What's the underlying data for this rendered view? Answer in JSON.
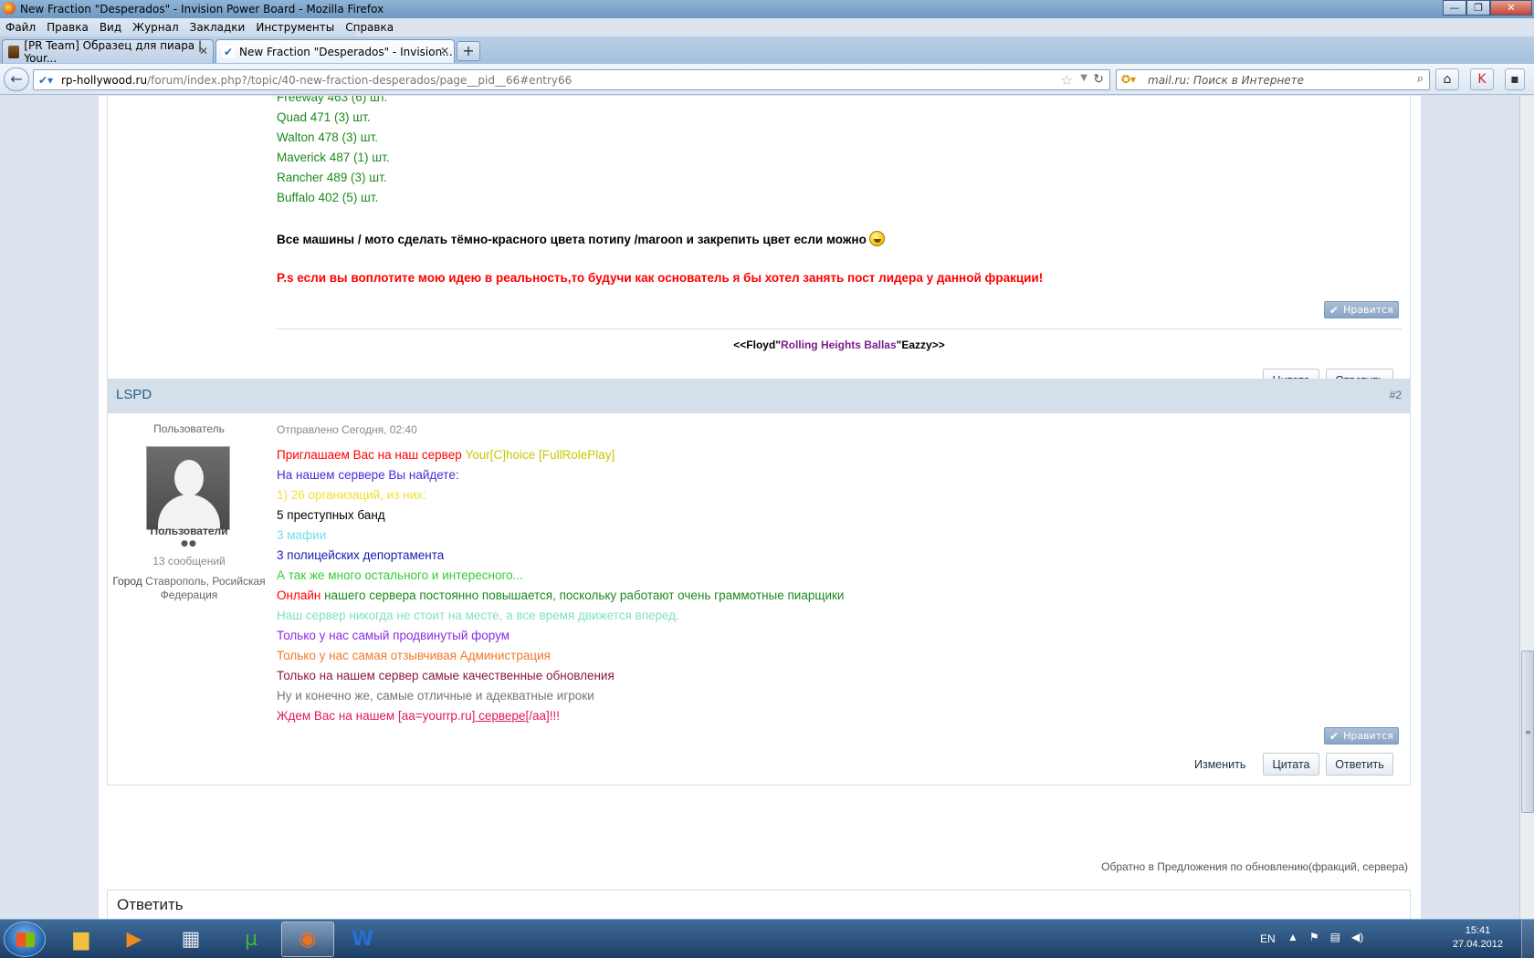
{
  "window": {
    "title": "New Fraction \"Desperados\" - Invision Power Board - Mozilla Firefox"
  },
  "menu": [
    "Файл",
    "Правка",
    "Вид",
    "Журнал",
    "Закладки",
    "Инструменты",
    "Справка"
  ],
  "tabs": [
    {
      "label": "[PR Team] Образец для пиара | Your...",
      "active": false
    },
    {
      "label": "New Fraction \"Desperados\" - Invision...",
      "active": true
    }
  ],
  "urlbar": {
    "domain": "rp-hollywood.ru",
    "path": "/forum/index.php?/topic/40-new-fraction-desperados/page__pid__66#entry66"
  },
  "search": {
    "placeholder": "mail.ru: Поиск в Интернете"
  },
  "post1": {
    "vehicles": [
      "Freeway 463 (6) шт.",
      "Quad 471 (3) шт.",
      "Walton 478 (3) шт.",
      "Maverick 487 (1) шт.",
      "Rancher 489 (3) шт.",
      "Buffalo 402 (5) шт."
    ],
    "note": "Все машины / мото сделать тёмно-красного цвета потипу /maroon и закрепить цвет если можно",
    "ps": "P.s если вы воплотите мою идею в реальность,то будучи как основатель я бы хотел занять пост лидера у данной фракции!",
    "like_label": "Нравится",
    "signature": {
      "part1": "<<Floyd\"",
      "part2": "Rolling Heights Ballas",
      "part3": "\"Eazzy>>"
    },
    "quote_label": "Цитата",
    "reply_label": "Ответить"
  },
  "post2": {
    "author": "LSPD",
    "number": "#2",
    "user_title": "Пользователь",
    "group": "Пользователи",
    "rank_dots": "●●",
    "posts_count": "13 сообщений",
    "city_label": "Город",
    "city_value": "Ставрополь, Росийская Федерация",
    "timestamp": "Отправлено Сегодня, 02:40",
    "lines": {
      "l1a": "Приглашаем Вас на наш сервер ",
      "l1b": "Your[C]hoice [FullRolePlay]",
      "l2": "На нашем сервере Вы найдете:",
      "l3": "1) 26 организаций, из них:",
      "l4": "5 преступных банд",
      "l5": "3 мафии",
      "l6": "3 полицейских депортамента",
      "l7": "А так же много остального и интересного...",
      "l8a": "Онлайн",
      "l8b": " нашего сервера постоянно повышается, поскольку работают очень граммотные пиарщики",
      "l9": "Наш сервер никогда не стоит на месте, а все время движется вперед.",
      "l10": "Только у нас самый продвинутый форум",
      "l11": "Только у нас самая отзывчивая Администрация",
      "l12": "Только на нашем сервер самые качественные обновления",
      "l13": "Ну и конечно же, самые отличные и адекватные игроки",
      "l14a": "Ждем Вас на нашем [aa=yourrp.ru]",
      "l14b": " сервере",
      "l14c": "[/aa]!!!"
    },
    "like_label": "Нравится",
    "edit_label": "Изменить",
    "quote_label": "Цитата",
    "reply_label": "Ответить"
  },
  "back_link": "Обратно в Предложения по обновлению(фракций, сервера)",
  "reply_heading": "Ответить",
  "taskbar": {
    "lang": "EN",
    "time": "15:41",
    "date": "27.04.2012"
  },
  "colors": {
    "vehicle_green": "#1c8a1c",
    "ps_red": "#ff0000",
    "signature_purple": "#7b1f8f"
  }
}
